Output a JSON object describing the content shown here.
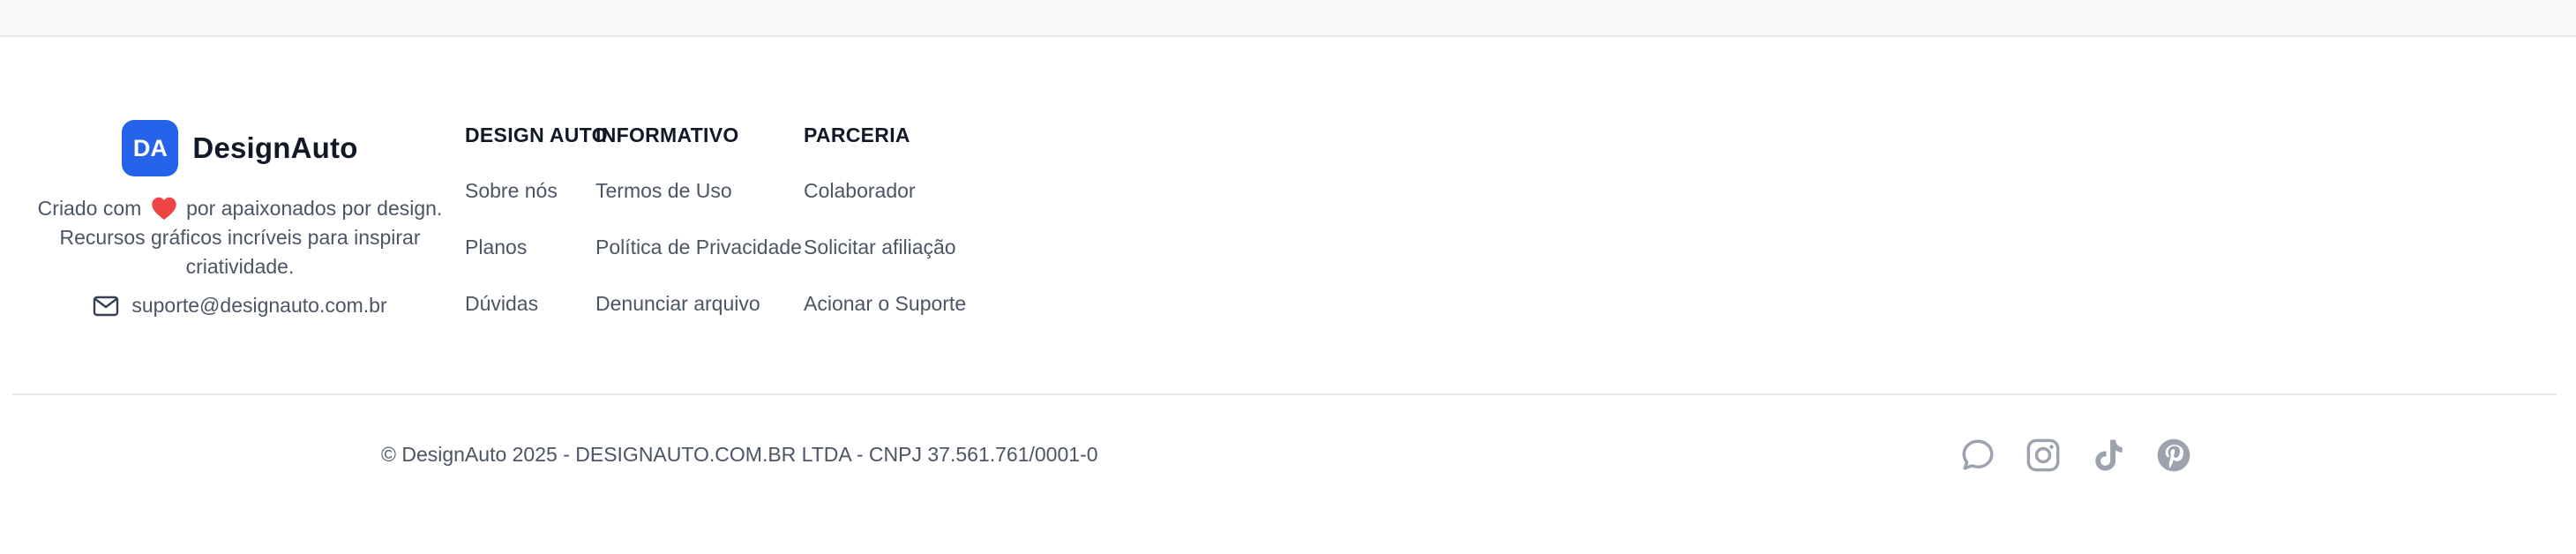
{
  "brand": {
    "logo_text": "DA",
    "name": "DesignAuto",
    "tagline_before": "Criado com",
    "tagline_after": "por apaixonados por design. Recursos gráficos incríveis para inspirar criatividade.",
    "email": "suporte@designauto.com.br"
  },
  "columns": [
    {
      "heading": "DESIGN AUTO",
      "links": [
        "Sobre nós",
        "Planos",
        "Dúvidas"
      ]
    },
    {
      "heading": "INFORMATIVO",
      "links": [
        "Termos de Uso",
        "Política de Privacidade",
        "Denunciar arquivo"
      ]
    },
    {
      "heading": "PARCERIA",
      "links": [
        "Colaborador",
        "Solicitar afiliação",
        "Acionar o Suporte"
      ]
    }
  ],
  "copyright": "© DesignAuto 2025 - DESIGNAUTO.COM.BR LTDA - CNPJ 37.561.761/0001-0",
  "socials": [
    {
      "icon": "chat-icon"
    },
    {
      "icon": "instagram-icon"
    },
    {
      "icon": "tiktok-icon"
    },
    {
      "icon": "pinterest-icon"
    }
  ],
  "colors": {
    "accent": "#2563eb",
    "heart": "#ef4444",
    "muted_text": "#4b5563",
    "icon_gray": "#9ca3af"
  }
}
